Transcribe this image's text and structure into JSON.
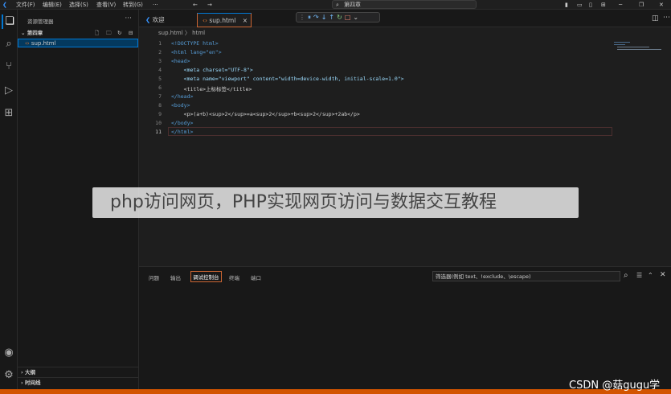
{
  "menu": [
    "文件(F)",
    "编辑(E)",
    "选择(S)",
    "查看(V)",
    "转到(G)"
  ],
  "command_center": "第四章",
  "sidebar": {
    "title": "资源管理器",
    "more": "···",
    "folder": "第四章",
    "file": "sup.html",
    "outline": "大纲",
    "timeline": "时间线"
  },
  "tabs": [
    {
      "label": "欢迎"
    },
    {
      "label": "sup.html",
      "close": "×"
    }
  ],
  "breadcrumb": "sup.html 〉 html",
  "editor": {
    "line_numbers": [
      "1",
      "2",
      "3",
      "4",
      "5",
      "6",
      "7",
      "8",
      "9",
      "10",
      "11"
    ],
    "lines": [
      "<!DOCTYPE html>",
      "<html lang=\"en\">",
      "<head>",
      "    <meta charset=\"UTF-8\">",
      "    <meta name=\"viewport\" content=\"width=device-width, initial-scale=1.0\">",
      "    <title>上标标签</title>",
      "</head>",
      "<body>",
      "    <p>(a+b)<sup>2</sup>=a<sup>2</sup>+b<sup>2</sup>+2ab</p>",
      "</body>",
      "</html>"
    ]
  },
  "panel": {
    "tabs": [
      "问题",
      "输出",
      "调试控制台",
      "终端",
      "端口"
    ],
    "active_tab": "调试控制台",
    "filter_placeholder": "筛选器(例如 text、!exclude、\\escape)"
  },
  "watermark": "php访问网页，PHP实现网页访问与数据交互教程",
  "csdn_watermark": "CSDN @菇gugu学",
  "colors": {
    "accent": "#0078d4",
    "statusbar": "#d35400",
    "tag": "#569cd6",
    "attr": "#9cdcfe",
    "string": "#ce9178"
  }
}
